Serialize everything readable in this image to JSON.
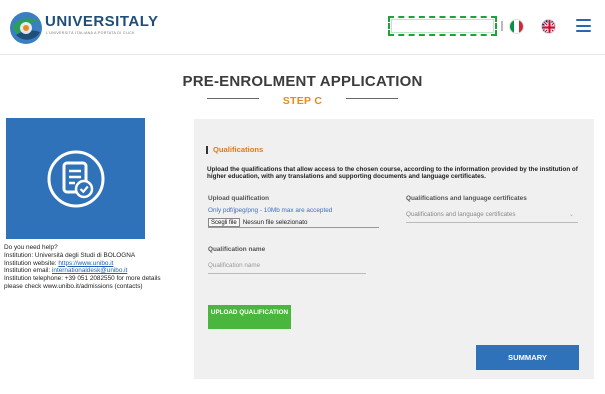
{
  "header": {
    "logo_word": "UNIVERSITALY",
    "logo_subtitle": "L'UNIVERSITÀ ITALIANA A PORTATA DI CLICK",
    "search_value": "",
    "language_flags": [
      "italian-flag-icon",
      "uk-flag-icon"
    ],
    "menu_icon": "hamburger-menu-icon"
  },
  "page": {
    "title": "PRE-ENROLMENT APPLICATION",
    "step": "STEP C"
  },
  "help": {
    "question": "Do you need help?",
    "institution_label": "Institution:",
    "institution_name": "Università degli Studi di BOLOGNA",
    "website_label": "Institution website:",
    "website": "https://www.unibo.it",
    "email_label": "Institution email:",
    "email": "internationaldesk@unibo.it",
    "phone_label": "Institution telephone:",
    "phone_note": "+39 051 2082550 for more details please check www.unibo.it/admissions (contacts)"
  },
  "form": {
    "section_title": "Qualifications",
    "description": "Upload the qualifications that allow access to the chosen course, according to the information provided by the institution of higher education, with any translations and supporting documents and language certificates.",
    "upload_label": "Upload qualification",
    "upload_hint": "Only pdf/jpeg/png - 10Mb max are accepted",
    "file_button": "Scegli file",
    "file_status": "Nessun file selezionato",
    "certificates_label": "Qualifications and language certificates",
    "certificates_placeholder": "Qualifications and language certificates",
    "name_label": "Qualification name",
    "name_placeholder": "Qualification name",
    "upload_button": "UPLOAD QUALIFICATION",
    "summary_button": "SUMMARY"
  },
  "colors": {
    "accent_orange": "#e07a1a",
    "primary_blue": "#2f72b9",
    "upload_green": "#4bb63e",
    "card_bg": "#f0f0f0"
  }
}
